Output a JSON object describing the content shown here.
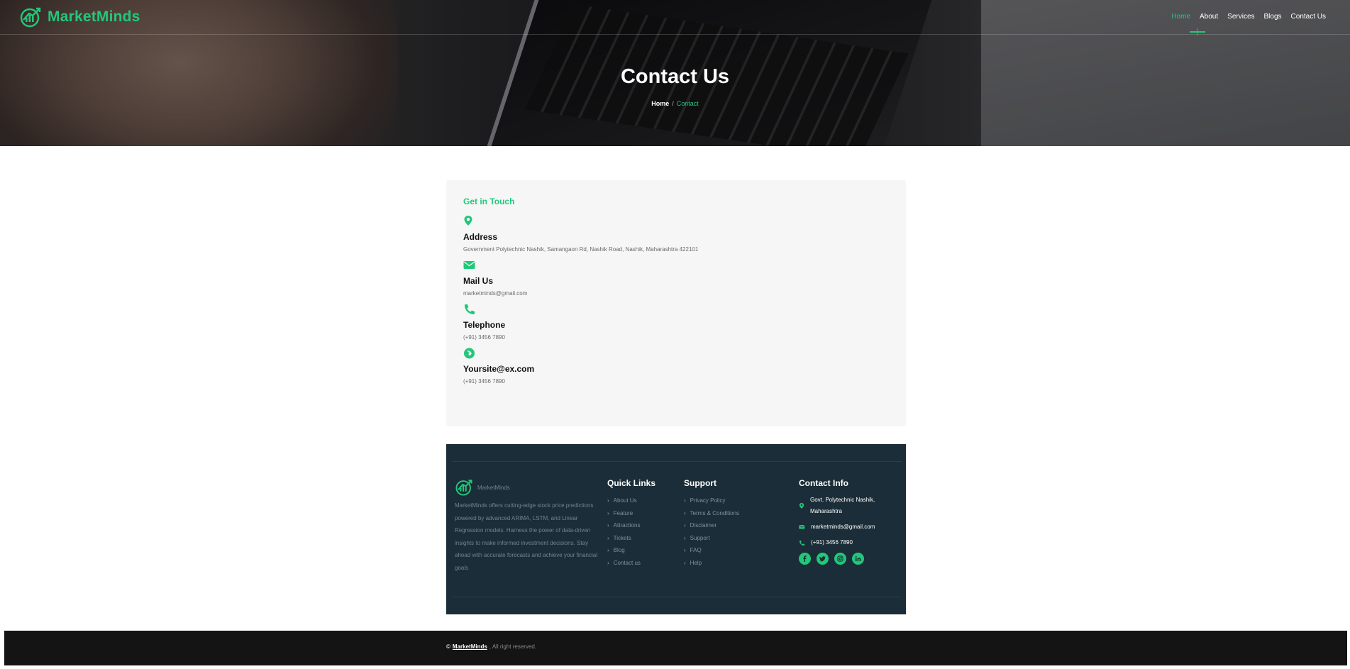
{
  "brand": {
    "name": "MarketMinds",
    "accent": "#22c87a"
  },
  "nav": {
    "items": [
      {
        "label": "Home",
        "active": true
      },
      {
        "label": "About",
        "active": false
      },
      {
        "label": "Services",
        "active": false
      },
      {
        "label": "Blogs",
        "active": false
      },
      {
        "label": "Contact Us",
        "active": false
      }
    ]
  },
  "hero": {
    "title": "Contact Us",
    "breadcrumb": {
      "home": "Home",
      "separator": "/",
      "current": "Contact"
    }
  },
  "contact": {
    "heading": "Get in Touch",
    "items": [
      {
        "icon": "map-pin-icon",
        "title": "Address",
        "text": "Government Polytechnic Nashik, Samangaon Rd, Nashik Road, Nashik, Maharashtra 422101"
      },
      {
        "icon": "envelope-icon",
        "title": "Mail Us",
        "text": "marketminds@gmail.com"
      },
      {
        "icon": "phone-icon",
        "title": "Telephone",
        "text": "(+91) 3456 7890"
      },
      {
        "icon": "web-icon",
        "title": "Yoursite@ex.com",
        "text": "(+91) 3456 7890"
      }
    ]
  },
  "footer": {
    "brand_name": "MarketMinds",
    "description": "MarketMinds offers cutting-edge stock price predictions powered by advanced ARIMA, LSTM, and Linear Regression models. Harness the power of data-driven insights to make informed investment decisions. Stay ahead with accurate forecasts and achieve your financial goals",
    "quick_links": {
      "title": "Quick Links",
      "items": [
        "About Us",
        "Feature",
        "Attractions",
        "Tickets",
        "Blog",
        "Contact us"
      ]
    },
    "support": {
      "title": "Support",
      "items": [
        "Privacy Policy",
        "Terms & Conditions",
        "Disclaimer",
        "Support",
        "FAQ",
        "Help"
      ]
    },
    "contact_info": {
      "title": "Contact Info",
      "address": "Govt. Polytechnic Nashik, Maharashtra",
      "email": "marketminds@gmail.com",
      "phone": "(+91) 3456 7890",
      "socials": [
        "facebook-icon",
        "twitter-icon",
        "instagram-icon",
        "linkedin-icon"
      ]
    }
  },
  "bottom_bar": {
    "copyright_symbol": "©",
    "brand": "MarketMinds",
    "rights": ", All right reserved."
  }
}
